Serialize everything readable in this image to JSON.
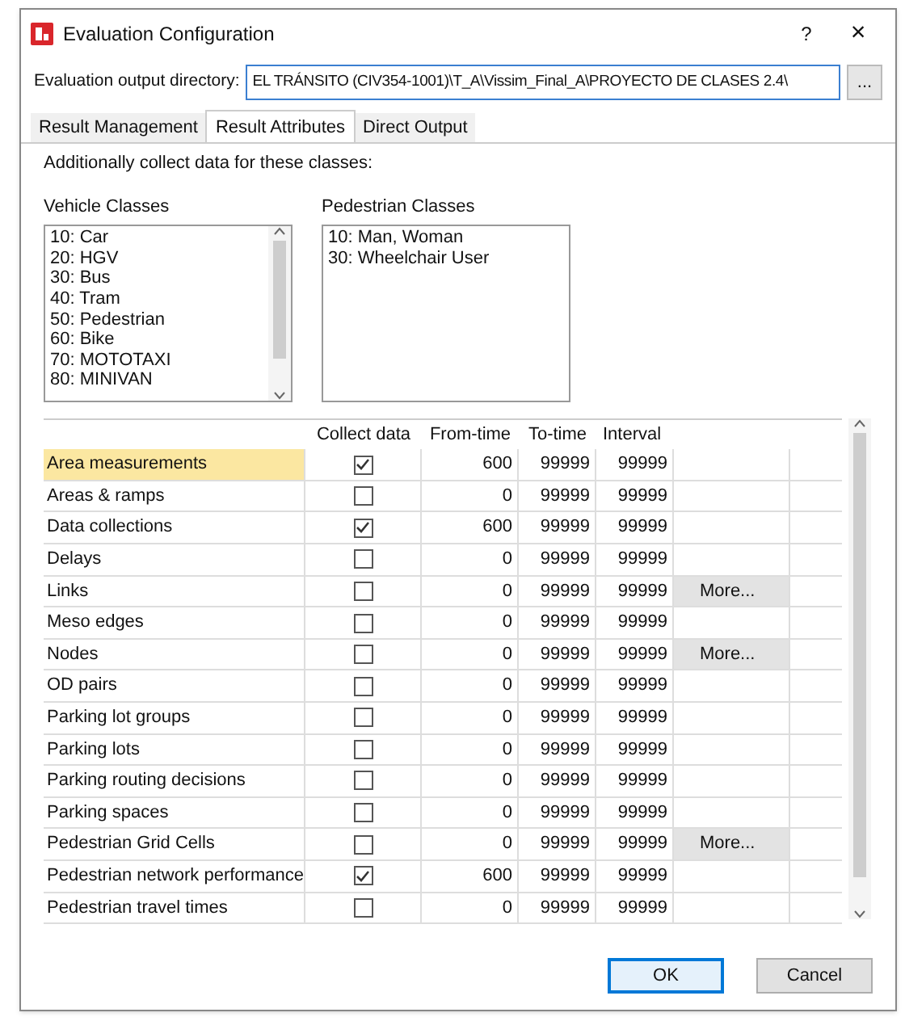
{
  "window": {
    "title": "Evaluation Configuration",
    "help": "?",
    "close": "×"
  },
  "output_directory": {
    "label": "Evaluation output directory:",
    "value": "EL TRÁNSITO (CIV354-1001)\\T_A\\Vissim_Final_A\\PROYECTO DE CLASES 2.4\\",
    "browse": "..."
  },
  "tabs": [
    {
      "label": "Result Management",
      "selected": false
    },
    {
      "label": "Result Attributes",
      "selected": true
    },
    {
      "label": "Direct Output",
      "selected": false
    }
  ],
  "intro": "Additionally collect data for these classes:",
  "vehicle_classes": {
    "label": "Vehicle Classes",
    "items": [
      "10: Car",
      "20: HGV",
      "30: Bus",
      "40: Tram",
      "50: Pedestrian",
      "60: Bike",
      "70: MOTOTAXI",
      "80: MINIVAN"
    ]
  },
  "pedestrian_classes": {
    "label": "Pedestrian Classes",
    "items": [
      "10: Man, Woman",
      "30: Wheelchair User"
    ]
  },
  "table": {
    "columns": [
      "Collect data",
      "From-time",
      "To-time",
      "Interval"
    ],
    "rows": [
      {
        "name": "Area measurements",
        "selected": true,
        "checked": true,
        "from": "600",
        "to": "99999",
        "interval": "99999"
      },
      {
        "name": "Areas & ramps",
        "selected": false,
        "checked": false,
        "from": "0",
        "to": "99999",
        "interval": "99999"
      },
      {
        "name": "Data collections",
        "selected": false,
        "checked": true,
        "from": "600",
        "to": "99999",
        "interval": "99999"
      },
      {
        "name": "Delays",
        "selected": false,
        "checked": false,
        "from": "0",
        "to": "99999",
        "interval": "99999"
      },
      {
        "name": "Links",
        "selected": false,
        "checked": false,
        "from": "0",
        "to": "99999",
        "interval": "99999",
        "more": "More..."
      },
      {
        "name": "Meso edges",
        "selected": false,
        "checked": false,
        "from": "0",
        "to": "99999",
        "interval": "99999"
      },
      {
        "name": "Nodes",
        "selected": false,
        "checked": false,
        "from": "0",
        "to": "99999",
        "interval": "99999",
        "more": "More..."
      },
      {
        "name": "OD pairs",
        "selected": false,
        "checked": false,
        "from": "0",
        "to": "99999",
        "interval": "99999"
      },
      {
        "name": "Parking lot groups",
        "selected": false,
        "checked": false,
        "from": "0",
        "to": "99999",
        "interval": "99999"
      },
      {
        "name": "Parking lots",
        "selected": false,
        "checked": false,
        "from": "0",
        "to": "99999",
        "interval": "99999"
      },
      {
        "name": "Parking routing decisions",
        "selected": false,
        "checked": false,
        "from": "0",
        "to": "99999",
        "interval": "99999"
      },
      {
        "name": "Parking spaces",
        "selected": false,
        "checked": false,
        "from": "0",
        "to": "99999",
        "interval": "99999"
      },
      {
        "name": "Pedestrian Grid Cells",
        "selected": false,
        "checked": false,
        "from": "0",
        "to": "99999",
        "interval": "99999",
        "more": "More..."
      },
      {
        "name": "Pedestrian network performance",
        "selected": false,
        "checked": true,
        "from": "600",
        "to": "99999",
        "interval": "99999"
      },
      {
        "name": "Pedestrian travel times",
        "selected": false,
        "checked": false,
        "from": "0",
        "to": "99999",
        "interval": "99999"
      }
    ]
  },
  "buttons": [
    {
      "label": "OK",
      "kind": "default"
    },
    {
      "label": "Cancel",
      "kind": "normal"
    }
  ]
}
